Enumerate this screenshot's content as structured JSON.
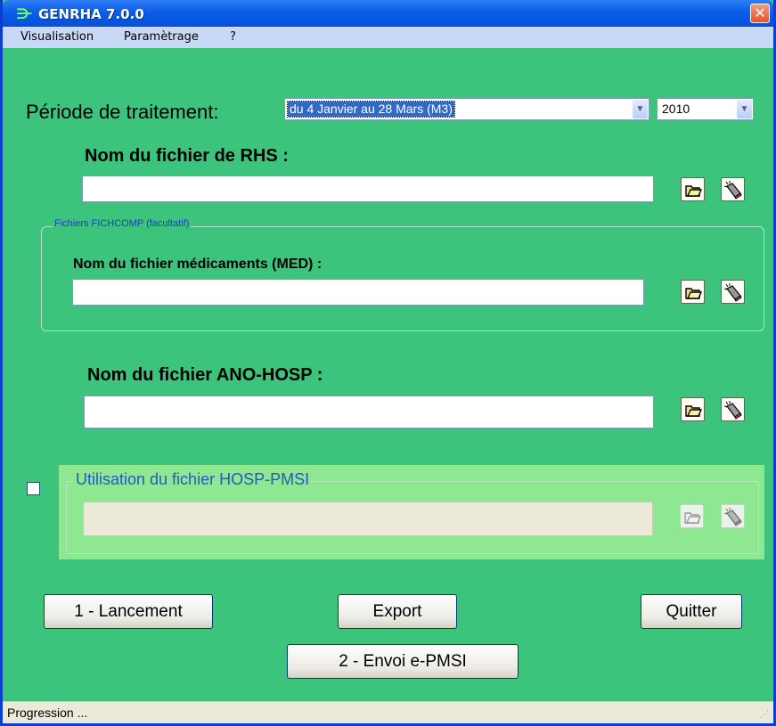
{
  "window": {
    "title": "GENRHA 7.0.0",
    "close_label": "✕",
    "app_icon_glyph": "⋺"
  },
  "menu": {
    "items": [
      "Visualisation",
      "Paramètrage",
      "?"
    ]
  },
  "period": {
    "label": "Période de traitement:",
    "selected": "du 4 Janvier au 28 Mars (M3)",
    "year": "2010"
  },
  "rhs": {
    "label": "Nom du fichier de RHS :",
    "value": ""
  },
  "fichcomp": {
    "legend": "Fichiers FICHCOMP (facultatif)",
    "med_label": "Nom du fichier médicaments (MED) :",
    "med_value": ""
  },
  "ano": {
    "label": "Nom du fichier ANO-HOSP :",
    "value": ""
  },
  "hosp": {
    "legend": "Utilisation du fichier HOSP-PMSI",
    "value": "",
    "checked": false
  },
  "buttons": {
    "launch": "1 - Lancement",
    "export": "Export",
    "quit": "Quitter",
    "send": "2 - Envoi e-PMSI"
  },
  "status": {
    "text": "Progression ..."
  },
  "icons": {
    "browse": "folder-open-icon",
    "clear": "eraser-icon"
  },
  "colors": {
    "background": "#3cc47c",
    "hosp_panel": "#8de891",
    "titlebar": "#0a5ee8"
  }
}
